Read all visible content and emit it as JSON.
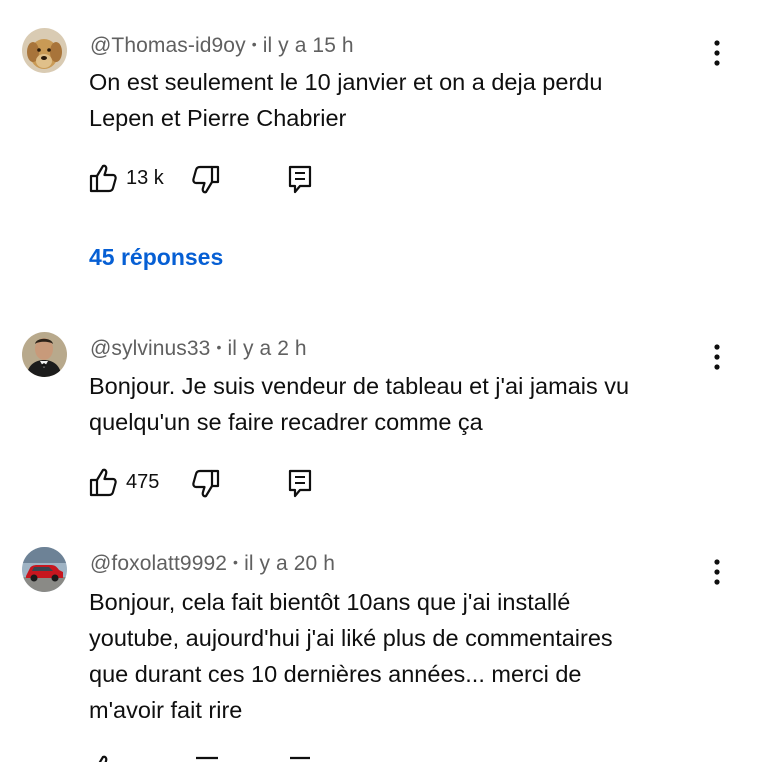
{
  "comments": [
    {
      "author": "@Thomas-id9oy",
      "time": "il y a 15 h",
      "lines": [
        "On est seulement le 10 janvier et on a deja perdu",
        "Lepen et Pierre Chabrier"
      ],
      "likes": "13 k",
      "replies": "45 réponses",
      "avatar": "dog-avatar"
    },
    {
      "author": "@sylvinus33",
      "time": "il y a 2 h",
      "lines": [
        "Bonjour. Je suis vendeur de tableau et j'ai jamais vu",
        "quelqu'un se faire recadrer comme ça"
      ],
      "likes": "475",
      "avatar": "man-in-suit-avatar"
    },
    {
      "author": "@foxolatt9992",
      "time": "il y a 20 h",
      "lines": [
        "Bonjour, cela fait bientôt 10ans que j'ai installé",
        "youtube, aujourd'hui j'ai liké plus de commentaires",
        "que durant ces 10 dernières années... merci de",
        "m'avoir fait rire"
      ],
      "avatar": "red-car-avatar"
    }
  ],
  "colors": {
    "text": "#0f0f0f",
    "meta": "#606060",
    "link": "#065fd4"
  }
}
